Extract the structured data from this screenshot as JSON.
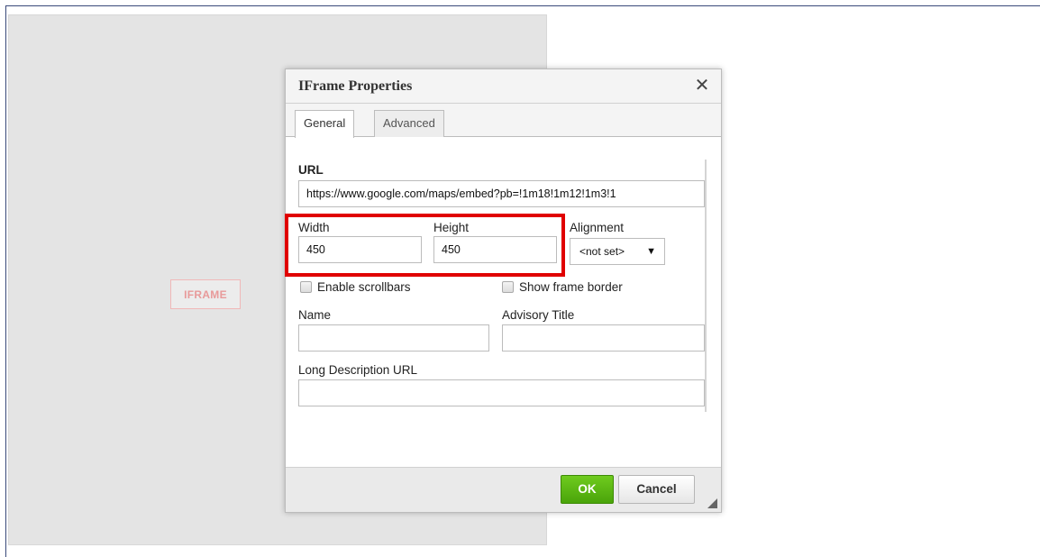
{
  "editor": {
    "placeholder_label": "IFRAME"
  },
  "dialog": {
    "title": "IFrame Properties",
    "close_icon": "✕",
    "tabs": [
      {
        "label": "General",
        "active": true
      },
      {
        "label": "Advanced",
        "active": false
      }
    ],
    "url": {
      "label": "URL",
      "value": "https://www.google.com/maps/embed?pb=!1m18!1m12!1m3!1"
    },
    "width": {
      "label": "Width",
      "value": "450"
    },
    "height": {
      "label": "Height",
      "value": "450"
    },
    "alignment": {
      "label": "Alignment",
      "selected": "<not set>"
    },
    "checkboxes": {
      "scrollbars": {
        "label": "Enable scrollbars",
        "checked": false
      },
      "frame_border": {
        "label": "Show frame border",
        "checked": false
      }
    },
    "name": {
      "label": "Name",
      "value": ""
    },
    "advisory_title": {
      "label": "Advisory Title",
      "value": ""
    },
    "long_desc": {
      "label": "Long Description URL",
      "value": ""
    },
    "footer": {
      "ok_label": "OK",
      "cancel_label": "Cancel"
    }
  },
  "colors": {
    "ok_button": "#5cb812",
    "highlight": "#e00000"
  }
}
